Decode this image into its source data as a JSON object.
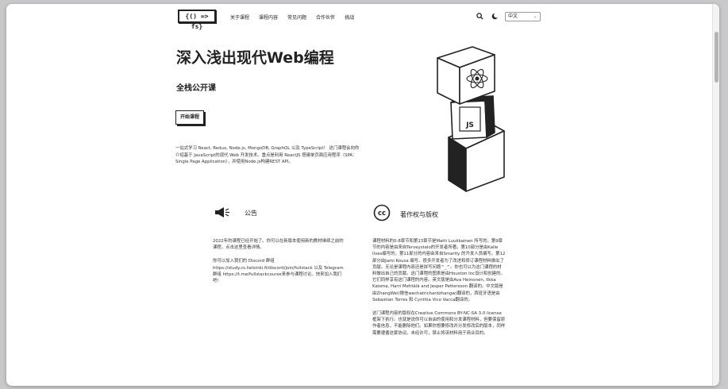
{
  "header": {
    "logo_text": "{() => fs}",
    "nav": [
      "关于课程",
      "课程内容",
      "常见问题",
      "合作伙伴",
      "挑战"
    ],
    "icons": [
      "search-icon",
      "moon-icon"
    ],
    "language": "中文"
  },
  "hero": {
    "title": "深入浅出现代Web编程",
    "subtitle": "全栈公开课",
    "start_button": "开始课程",
    "description": "一站式学习 React, Redux, Node.js, MongoDB, GraphQL 以及 TypeScript！ 这门课程会向你介绍基于 JavaScript的现代 Web 开发技术。重点是利用 ReactJS 搭建单页面应用程序（SPA：Single Page Application），并使用Node.js构建REST API。",
    "illustration": {
      "icons": [
        "react-logo-icon",
        "js-logo-icon"
      ],
      "js_label": "JS"
    }
  },
  "announcement": {
    "icon": "megaphone-icon",
    "title": "公告",
    "paragraphs": [
      "2022年的课程已经开始了。你可以在新版本使用新的教材继续之前的课程，点击这里查看详情。",
      "你可以加入我们的 Discord 群组 https://study.cs.helsinki.fi/discord/join/fullstack 以及 Telegram 群组 https://t.me/fullstackcourse来参与课程讨论。快来加入我们吧!"
    ]
  },
  "copyright": {
    "icon": "creative-commons-icon",
    "title": "著作权与版权",
    "paragraphs": [
      "课程材料的0-8章节和第13章节是Matti Luukkainen 所写的。第9章节的内容是由来自Terveystalo的开发者所著。第10部分是由Kalle Ilves编写的。第11部分的内容由来自Smartly 的开发人员编写。第12部分由Jami Kousa 编写。很多开发者为了改进和修订课程材料做出了贡献。无论是课程内容还是拼写问题^_^。你也可以为这门课程的材料做出自己的贡献。这门课程的图表是由Houston Inc设计和创建的。它们同样享有这门课程的内容。英文版是由Ava Heinonen, Ilkka Kaisma, Harri Mehtälä and Jesper Pettersson 翻译的。中文版是由ZhangWei(微信wechatrichardzhangw)翻译的，西班牙语是由Sebastian Torres 和 Cynthia Vico Vacca翻译的。",
      "这门课程内容的版权在Creative Commons BY-NC-SA 3.0 license框架下执行。也就是说你可以自由的使用和分发课程材料，但要保留原作者信息，不能删除他们。如果你想要修改并分发修改后的版本，同样需要遵循这套协议。未经许可，禁止将该材料用于商业目的。"
    ]
  }
}
